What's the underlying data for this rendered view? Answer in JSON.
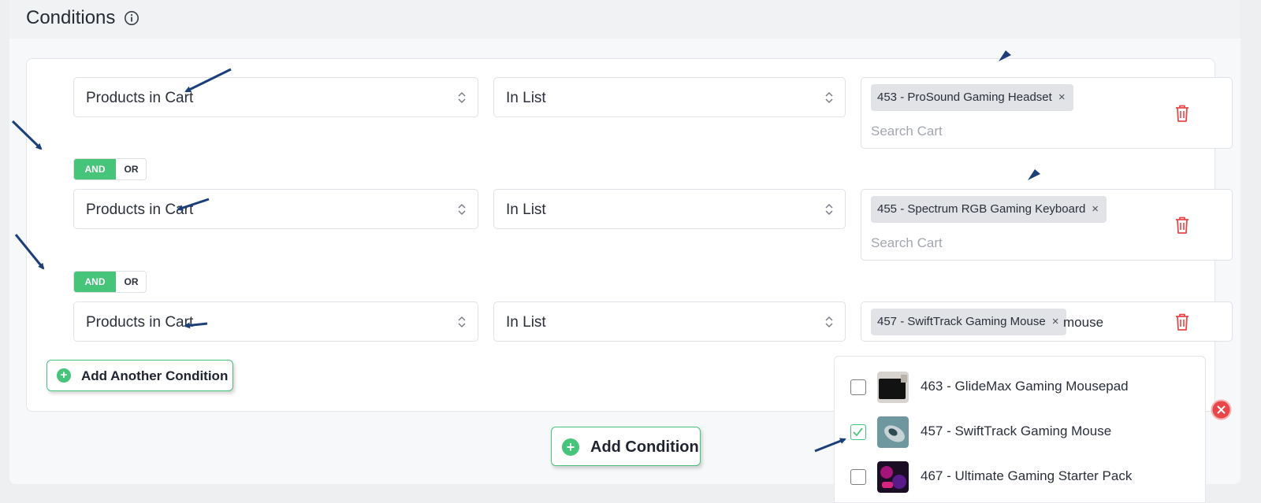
{
  "panel": {
    "title": "Conditions",
    "info_icon": "info-circle-icon"
  },
  "conditions": [
    {
      "field": "Products in Cart",
      "operator": "In List",
      "tag": "453 - ProSound Gaming Headset",
      "tag_remove": "×",
      "search_placeholder": "Search Cart",
      "typed": ""
    },
    {
      "field": "Products in Cart",
      "operator": "In List",
      "tag": "455 - Spectrum RGB Gaming Keyboard",
      "tag_remove": "×",
      "search_placeholder": "Search Cart",
      "typed": ""
    },
    {
      "field": "Products in Cart",
      "operator": "In List",
      "tag": "457 - SwiftTrack Gaming Mouse",
      "tag_remove": "×",
      "search_placeholder": "",
      "typed": "mouse"
    }
  ],
  "logic_toggles": [
    {
      "and": "AND",
      "or": "OR",
      "active": "AND"
    },
    {
      "and": "AND",
      "or": "OR",
      "active": "AND"
    }
  ],
  "buttons": {
    "add_another_condition": "Add Another Condition",
    "add_condition": "Add Condition",
    "plus_icon": "+"
  },
  "dropdown": {
    "options": [
      {
        "label": "463 - GlideMax Gaming Mousepad",
        "checked": false
      },
      {
        "label": "457 - SwiftTrack Gaming Mouse",
        "checked": true
      },
      {
        "label": "467 - Ultimate Gaming Starter Pack",
        "checked": false
      }
    ]
  },
  "colors": {
    "accent_green": "#46c479",
    "delete_red": "#e8474a",
    "annotation_arrow": "#1c3f7a"
  }
}
